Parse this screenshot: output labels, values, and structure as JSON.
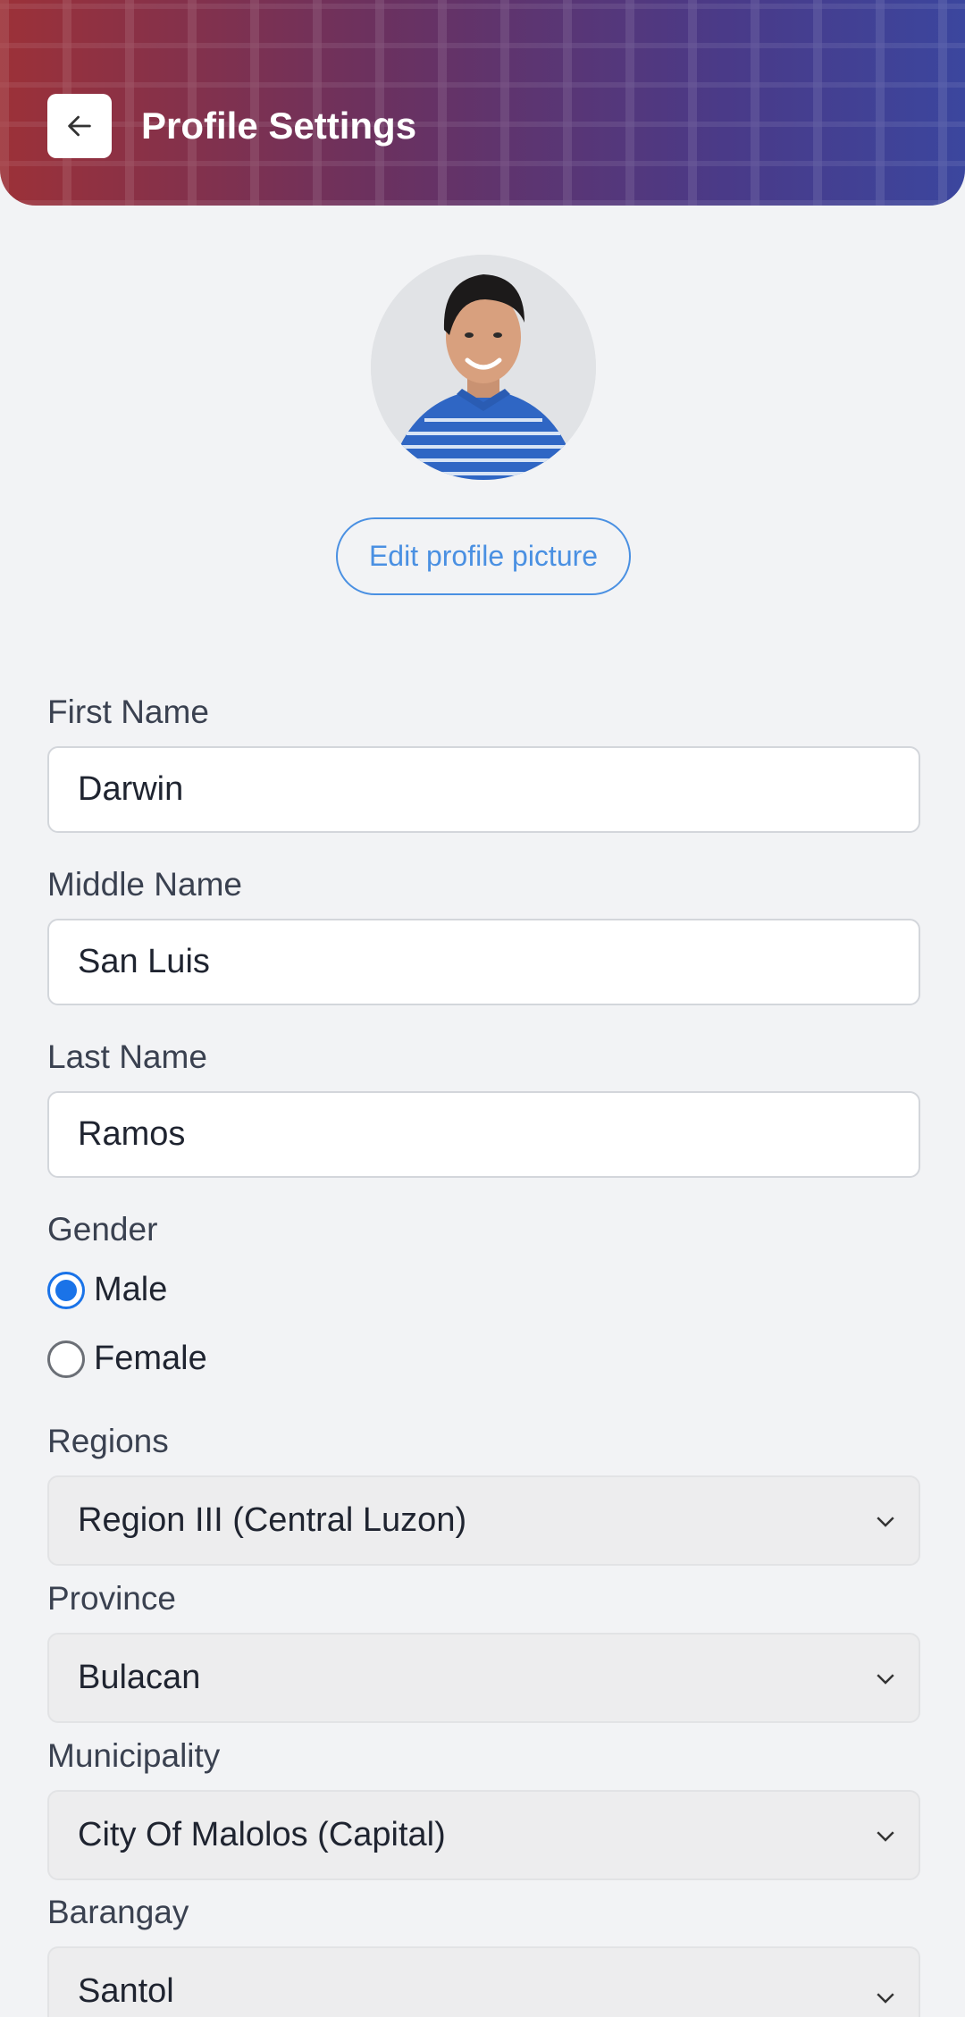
{
  "header": {
    "title": "Profile Settings",
    "back_icon": "arrow-left-icon",
    "gradient_start": "#9c3138",
    "gradient_end": "#3b469e"
  },
  "profile": {
    "edit_picture_label": "Edit profile picture"
  },
  "form": {
    "first_name": {
      "label": "First Name",
      "value": "Darwin"
    },
    "middle_name": {
      "label": "Middle Name",
      "value": "San Luis"
    },
    "last_name": {
      "label": "Last Name",
      "value": "Ramos"
    },
    "gender": {
      "label": "Gender",
      "options": [
        {
          "label": "Male",
          "selected": true
        },
        {
          "label": "Female",
          "selected": false
        }
      ]
    },
    "region": {
      "label": "Regions",
      "value": "Region III (Central Luzon)"
    },
    "province": {
      "label": "Province",
      "value": "Bulacan"
    },
    "municipality": {
      "label": "Municipality",
      "value": "City Of Malolos (Capital)"
    },
    "barangay": {
      "label": "Barangay",
      "value": "Santol"
    }
  },
  "colors": {
    "accent": "#4a90e2",
    "radio_selected": "#1a73e8"
  }
}
